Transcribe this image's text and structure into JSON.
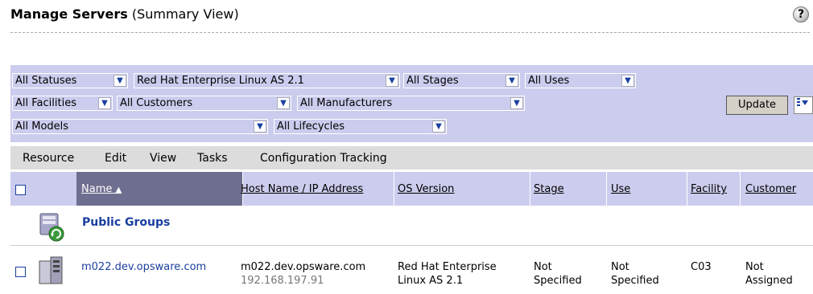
{
  "page": {
    "title_bold": "Manage Servers",
    "title_rest": " (Summary View)",
    "help_glyph": "?"
  },
  "filters": {
    "status": "All Statuses",
    "os": "Red Hat Enterprise Linux AS 2.1",
    "stage": "All Stages",
    "use": "All Uses",
    "facility": "All Facilities",
    "customer": "All Customers",
    "manufacturer": "All Manufacturers",
    "model": "All Models",
    "lifecycle": "All Lifecycles",
    "update_label": "Update"
  },
  "menu": {
    "resource": "Resource",
    "edit": "Edit",
    "view": "View",
    "tasks": "Tasks",
    "config": "Configuration Tracking"
  },
  "table": {
    "headers": {
      "name": "Name",
      "sort_indicator": "▲",
      "host": "Host Name",
      "slash": " / ",
      "ip": "IP Address",
      "os": "OS Version",
      "stage": "Stage",
      "use": "Use",
      "facility": "Facility",
      "customer": "Customer"
    },
    "group": {
      "label": "Public Groups"
    },
    "rows": [
      {
        "name": "m022.dev.opsware.com",
        "host": "m022.dev.opsware.com",
        "ip": "192.168.197.91",
        "os_line1": "Red Hat Enterprise",
        "os_line2": "Linux AS 2.1",
        "stage_line1": "Not",
        "stage_line2": "Specified",
        "use_line1": "Not",
        "use_line2": "Specified",
        "facility": "C03",
        "customer_line1": "Not",
        "customer_line2": "Assigned"
      }
    ]
  },
  "colors": {
    "accent_link": "#1a3fa0",
    "filter_bg": "#ccccee",
    "sorted_header": "#6e6e90",
    "menubar_bg": "#dcdcdc"
  },
  "icons": [
    "help-icon",
    "dropdown-arrow-icon",
    "column-chooser-icon",
    "server-group-icon",
    "server-icon"
  ]
}
